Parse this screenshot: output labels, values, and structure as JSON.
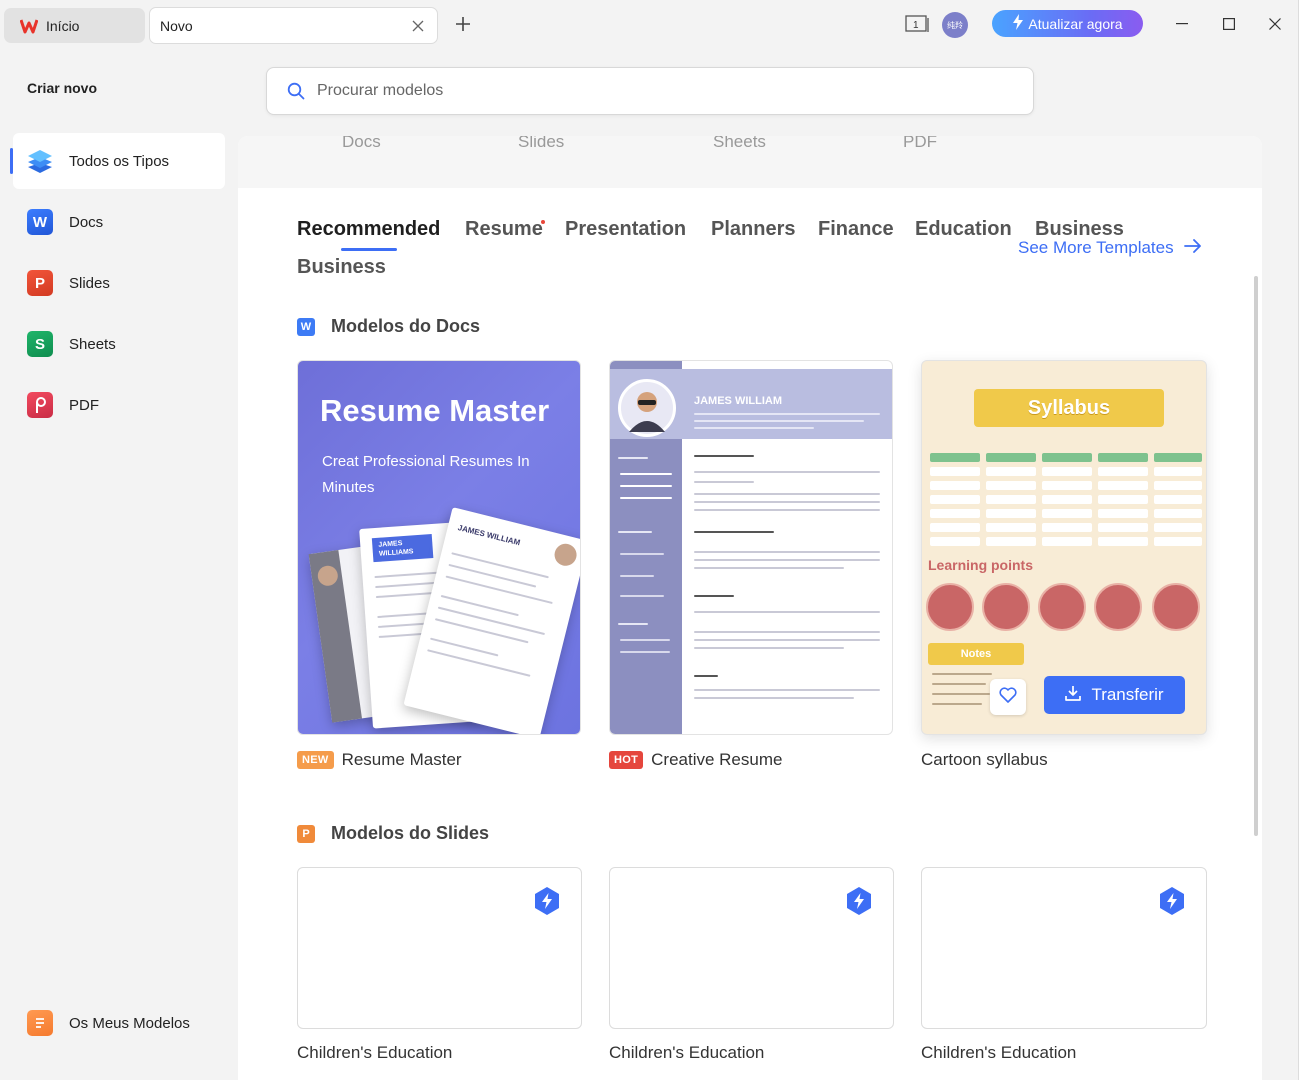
{
  "tabs": {
    "home_label": "Início",
    "new_label": "Novo"
  },
  "titlebar": {
    "window_count": "1",
    "avatar_text": "纯羚",
    "upgrade_label": "Atualizar agora"
  },
  "sidebar": {
    "title": "Criar novo",
    "items": [
      {
        "label": "Todos os Tipos",
        "icon": "layers-icon"
      },
      {
        "label": "Docs",
        "icon": "docs-icon",
        "letter": "W"
      },
      {
        "label": "Slides",
        "icon": "slides-icon",
        "letter": "P"
      },
      {
        "label": "Sheets",
        "icon": "sheets-icon",
        "letter": "S"
      },
      {
        "label": "PDF",
        "icon": "pdf-icon"
      }
    ],
    "my_templates": "Os Meus Modelos"
  },
  "search": {
    "placeholder": "Procurar modelos"
  },
  "type_tabs": [
    "Docs",
    "Slides",
    "Sheets",
    "PDF"
  ],
  "categories": [
    "Recommended",
    "Resume",
    "Presentation",
    "Planners",
    "Finance",
    "Education",
    "Business",
    "Business"
  ],
  "see_more": "See More Templates",
  "docs_section": {
    "title": "Modelos do Docs",
    "cards": [
      {
        "badge": "NEW",
        "label": "Resume Master",
        "preview_title": "Resume Master",
        "preview_sub": "Creat Professional Resumes In Minutes",
        "paper_name": "JAMES WILLIAMS"
      },
      {
        "badge": "HOT",
        "label": "Creative Resume",
        "preview_name": "JAMES WILLIAM"
      },
      {
        "label": "Cartoon syllabus",
        "preview_title": "Syllabus",
        "preview_lp": "Learning points",
        "preview_notes": "Notes",
        "download_label": "Transferir"
      }
    ]
  },
  "slides_section": {
    "title": "Modelos do Slides",
    "cards": [
      {
        "label": "Children's Education"
      },
      {
        "label": "Children's Education"
      },
      {
        "label": "Children's Education"
      }
    ]
  },
  "colors": {
    "accent": "#3d6ef5",
    "upgrade_start": "#4aa3ff",
    "upgrade_end": "#8a5cf0"
  }
}
